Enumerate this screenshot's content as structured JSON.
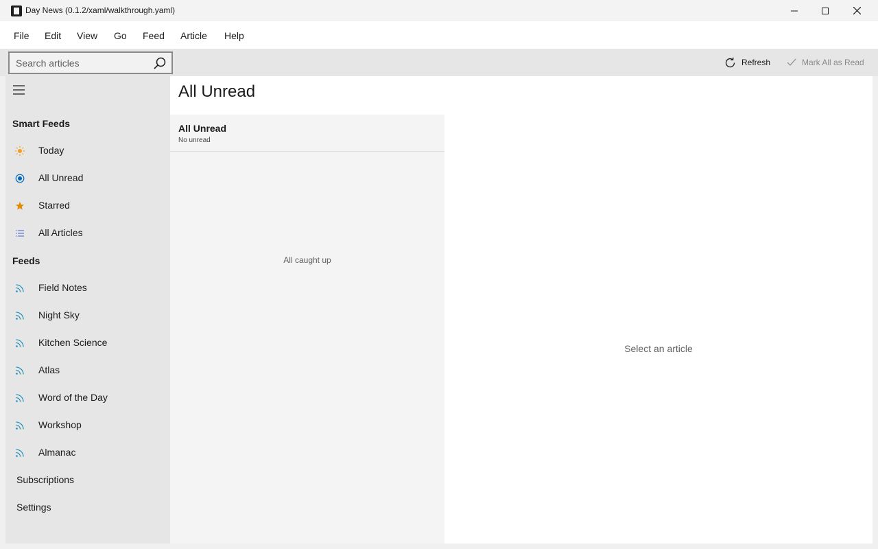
{
  "window": {
    "title": "Day News (0.1.2/xaml/walkthrough.yaml)"
  },
  "menu": [
    "File",
    "Edit",
    "View",
    "Go",
    "Feed",
    "Article",
    "Help"
  ],
  "toolbar": {
    "search_placeholder": "Search articles",
    "refresh_label": "Refresh",
    "mark_all_label": "Mark All as Read"
  },
  "sidebar": {
    "smart_feeds_title": "Smart Feeds",
    "smart_feeds": [
      {
        "label": "Today",
        "icon": "sun-icon"
      },
      {
        "label": "All Unread",
        "icon": "radio-selected-icon"
      },
      {
        "label": "Starred",
        "icon": "star-icon"
      },
      {
        "label": "All Articles",
        "icon": "list-icon"
      }
    ],
    "feeds_title": "Feeds",
    "feeds": [
      {
        "label": "Field Notes",
        "icon": "rss-icon"
      },
      {
        "label": "Night Sky",
        "icon": "rss-icon"
      },
      {
        "label": "Kitchen Science",
        "icon": "rss-icon"
      },
      {
        "label": "Atlas",
        "icon": "rss-icon"
      },
      {
        "label": "Word of the Day",
        "icon": "rss-icon"
      },
      {
        "label": "Workshop",
        "icon": "rss-icon"
      },
      {
        "label": "Almanac",
        "icon": "rss-icon"
      }
    ],
    "subscriptions_label": "Subscriptions",
    "settings_label": "Settings"
  },
  "main": {
    "title": "All Unread",
    "list": {
      "title": "All Unread",
      "subtitle": "No unread",
      "empty_message": "All caught up"
    },
    "reader": {
      "empty_message": "Select an article"
    }
  },
  "colors": {
    "accent": "#0067c0",
    "sun": "#f0a020",
    "star": "#e08a00",
    "list": "#4f6bd8",
    "rss": "#1f8fb6"
  }
}
